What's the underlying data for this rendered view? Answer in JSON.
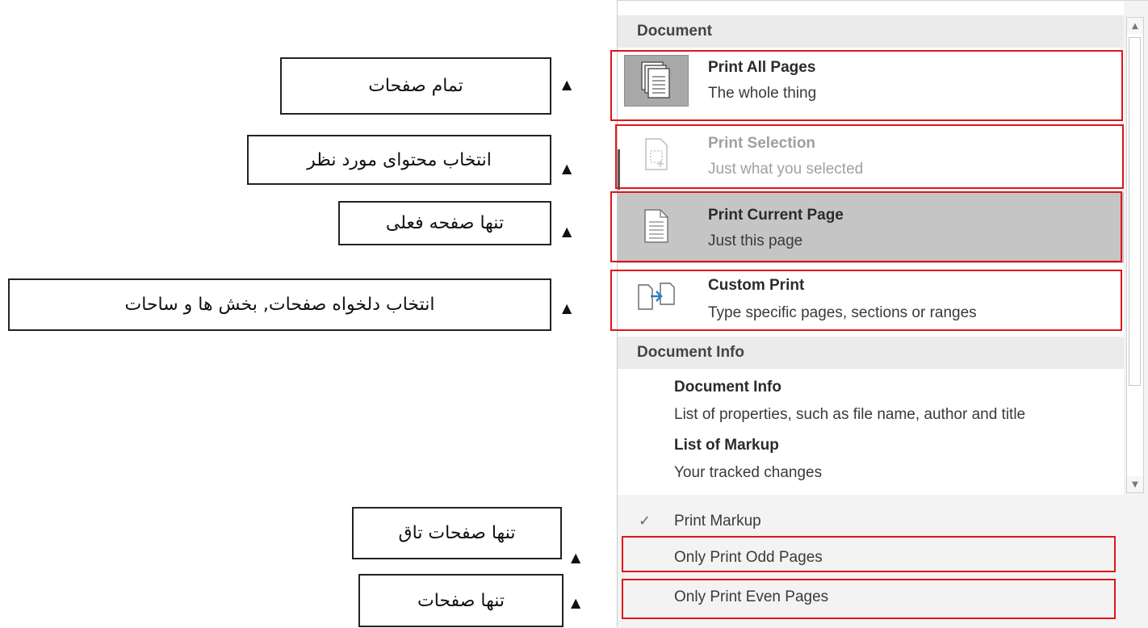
{
  "annotations": [
    {
      "text": "تمام صفحات"
    },
    {
      "text": "انتخاب محتوای مورد نظر"
    },
    {
      "text": "تنها صفحه فعلی"
    },
    {
      "text": "انتخاب دلخواه صفحات, بخش ها و ساحات"
    },
    {
      "text": "تنها صفحات تاق"
    },
    {
      "text": "تنها صفحات"
    }
  ],
  "arrow_glyph": "▲",
  "menu": {
    "section_document": "Document",
    "items": [
      {
        "title": "Print All Pages",
        "subtitle": "The whole thing",
        "icon": "pages-stack-icon"
      },
      {
        "title": "Print Selection",
        "subtitle": "Just what you selected",
        "icon": "selection-page-icon"
      },
      {
        "title": "Print Current Page",
        "subtitle": "Just this page",
        "icon": "single-page-icon"
      },
      {
        "title": "Custom Print",
        "subtitle": "Type specific pages, sections or ranges",
        "icon": "custom-pages-icon"
      }
    ],
    "section_info": "Document Info",
    "info_items": [
      {
        "title": "Document Info",
        "subtitle": "List of properties, such as file name, author and title"
      },
      {
        "title": "List of Markup",
        "subtitle": "Your tracked changes"
      }
    ],
    "options": [
      {
        "label": "Print Markup",
        "checked": true
      },
      {
        "label": "Only Print Odd Pages",
        "checked": false
      },
      {
        "label": "Only Print Even Pages",
        "checked": false
      }
    ],
    "check_glyph": "✓",
    "scroll_up": "▲",
    "scroll_down": "▼"
  },
  "colors": {
    "highlight_box": "#e0151b",
    "selected_item": "#c5c5c5",
    "section_header": "#ebebeb"
  }
}
